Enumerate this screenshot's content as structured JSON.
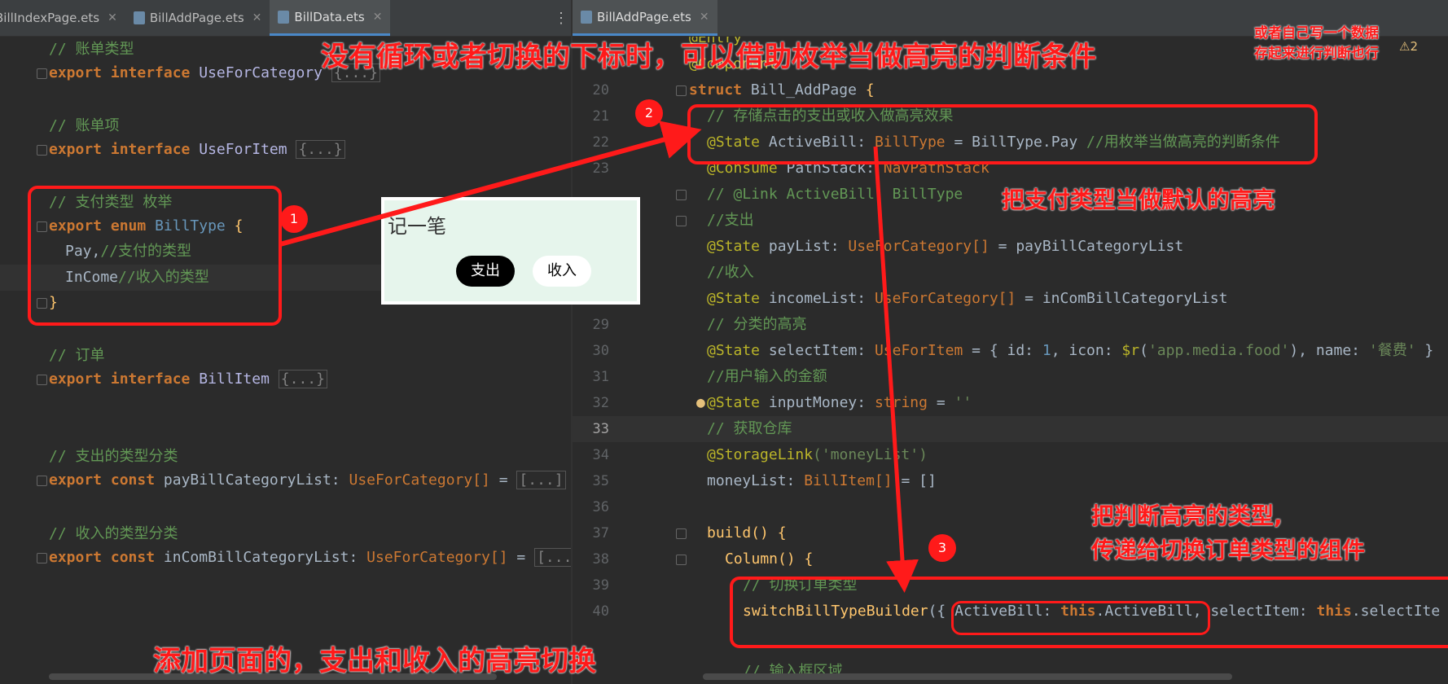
{
  "tabs_left": [
    {
      "label": "BillIndexPage.ets",
      "active": false
    },
    {
      "label": "BillAddPage.ets",
      "active": false
    },
    {
      "label": "BillData.ets",
      "active": true
    }
  ],
  "tabs_right": [
    {
      "label": "BillAddPage.ets",
      "active": true
    }
  ],
  "left_code": {
    "c_category": "// 账单类型",
    "category_kw": "export interface",
    "category_name": "UseForCategory",
    "folded": "{...}",
    "c_item": "// 账单项",
    "item_kw": "export interface",
    "item_name": "UseForItem",
    "c_enum": "// 支付类型 枚举",
    "enum_kw": "export enum",
    "enum_name": "BillType",
    "brace_open": "{",
    "pay": "Pay,",
    "pay_comment": "//支付的类型",
    "income": "InCome",
    "income_comment": "//收入的类型",
    "brace_close": "}",
    "c_order": "// 订单",
    "order_kw": "export interface",
    "order_name": "BillItem",
    "c_pay_list": "// 支出的类型分类",
    "pay_list_kw": "export const",
    "pay_list": "payBillCategoryList:",
    "pay_list_type": "UseForCategory[]",
    "eq": "=",
    "folded_list": "[...]",
    "c_income_list": "// 收入的类型分类",
    "income_list_kw": "export const",
    "income_list": "inComBillCategoryList:",
    "folded_list_short": "[..."
  },
  "right_code": {
    "l18": "@Entry",
    "l19": "@Component",
    "n20": "20",
    "l20_kw": "struct",
    "l20_name": "Bill_AddPage",
    "l20_brace": "{",
    "n21": "21",
    "l21": "// 存储点击的支出或收入做高亮效果",
    "n22": "22",
    "l22_ann": "@State",
    "l22_var": "ActiveBill:",
    "l22_type": "BillType",
    "l22_rest": "= BillType.Pay",
    "l22_cm": "//用枚举当做高亮的判断条件",
    "n23": "23",
    "l23_ann": "@Consume",
    "l23_var": "PathStack:",
    "l23_type": "NavPathStack",
    "l24": "// @Link ActiveBill: BillType",
    "l25": "//支出",
    "l26_ann": "@State",
    "l26_var": "payList:",
    "l26_type": "UseForCategory[]",
    "l26_rest": "= payBillCategoryList",
    "l27": "//收入",
    "l28_ann": "@State",
    "l28_var": "incomeList:",
    "l28_type": "UseForCategory[]",
    "l28_rest": "= inComBillCategoryList",
    "n29": "29",
    "l29": "// 分类的高亮",
    "n30": "30",
    "l30_ann": "@State",
    "l30_var": "selectItem:",
    "l30_type": "UseForItem",
    "l30_a": "= { id:",
    "l30_num": "1",
    "l30_b": ", icon:",
    "l30_fn": "$r",
    "l30_c": "(",
    "l30_str": "'app.media.food'",
    "l30_d": "), name:",
    "l30_str2": "'餐费'",
    "l30_e": "}",
    "n31": "31",
    "l31": "//用户输入的金额",
    "n32": "32",
    "l32_ann": "@State",
    "l32_var": "inputMoney:",
    "l32_type": "string",
    "l32_rest": "=",
    "l32_str": "''",
    "n33": "33",
    "l33": "// 获取仓库",
    "n34": "34",
    "l34_ann": "@StorageLink",
    "l34_str": "('moneyList')",
    "n35": "35",
    "l35_var": "moneyList:",
    "l35_type": "BillItem[]",
    "l35_rest": "= []",
    "n36": "36",
    "n37": "37",
    "l37": "build() {",
    "n38": "38",
    "l38": "Column() {",
    "n39": "39",
    "l39": "// 切换订单类型",
    "n40": "40",
    "l40_fn": "switchBillTypeBuilder",
    "l40_a": "({",
    "l40_b": "ActiveBill:",
    "l40_this": "this",
    "l40_c": ".ActiveBill,",
    "l40_d": "selectItem:",
    "l40_this2": "this",
    "l40_e": ".selectIte",
    "l41": "// 输入框区域"
  },
  "preview": {
    "title": "记一笔",
    "pay_label": "支出",
    "income_label": "收入"
  },
  "annotations": {
    "top": "没有循环或者切换的下标时，可以借助枚举当做高亮的判断条件",
    "top_right_1": "或者自己写一个数据",
    "top_right_2": "存起来进行判断也行",
    "default": "把支付类型当做默认的高亮",
    "pass_1": "把判断高亮的类型,",
    "pass_2": "传递给切换订单类型的组件",
    "bottom": "添加页面的，支出和收入的高亮切换",
    "badge1": "1",
    "badge2": "2",
    "badge3": "3"
  },
  "warning": "⚠2",
  "colors": {
    "annotation": "#ff1a1a",
    "editor_bg": "#2b2b2b"
  }
}
